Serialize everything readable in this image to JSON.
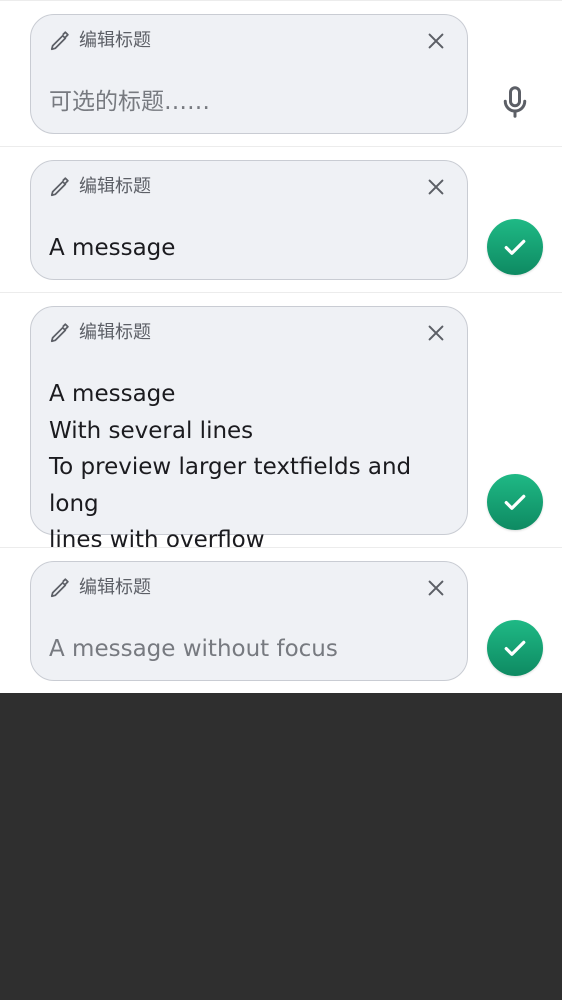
{
  "colors": {
    "card_background": "#eff1f5",
    "card_border": "#c9ccd3",
    "send_button": "#14a173",
    "page_background": "#2f2f2f",
    "panel_background": "#ffffff"
  },
  "rows": [
    {
      "header_label": "编辑标题",
      "header_icon": "pencil-icon",
      "close_icon": "close-icon",
      "text": "可选的标题……",
      "text_state": "placeholder",
      "action_icon": "microphone-icon"
    },
    {
      "header_label": "编辑标题",
      "header_icon": "pencil-icon",
      "close_icon": "close-icon",
      "text": "A message",
      "text_state": "value",
      "action_icon": "checkmark-icon"
    },
    {
      "header_label": "编辑标题",
      "header_icon": "pencil-icon",
      "close_icon": "close-icon",
      "text": "A message\nWith several lines\nTo preview larger textfields and long\nlines with overflow",
      "text_state": "value",
      "action_icon": "checkmark-icon"
    },
    {
      "header_label": "编辑标题",
      "header_icon": "pencil-icon",
      "close_icon": "close-icon",
      "text": "A message without focus",
      "text_state": "unfocused",
      "action_icon": "checkmark-icon"
    }
  ]
}
